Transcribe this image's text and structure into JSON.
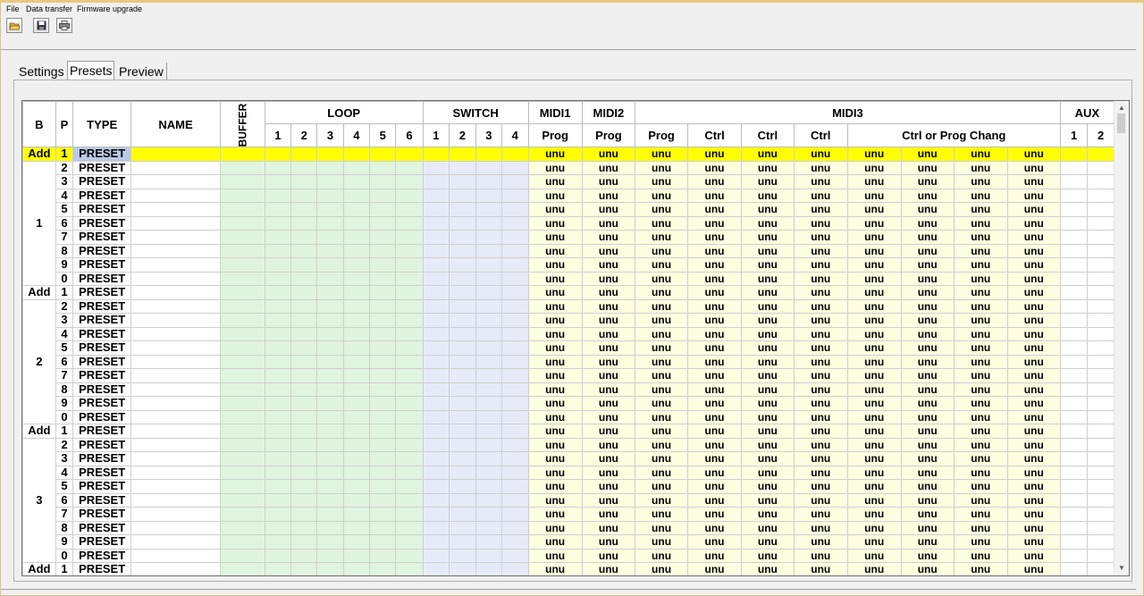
{
  "menu": [
    "File",
    "Data transfer",
    "Firmware upgrade"
  ],
  "toolbar": {
    "icons": [
      "open-folder-icon",
      "save-disk-icon",
      "print-icon"
    ]
  },
  "tabs": [
    {
      "label": "Settings",
      "active": false
    },
    {
      "label": "Presets",
      "active": true
    },
    {
      "label": "Preview",
      "active": false
    }
  ],
  "grid": {
    "headers": {
      "b": "B",
      "p": "P",
      "type": "TYPE",
      "name": "NAME",
      "buffer": "BUFFER",
      "loop": "LOOP",
      "loop_cols": [
        "1",
        "2",
        "3",
        "4",
        "5",
        "6"
      ],
      "switch": "SWITCH",
      "switch_cols": [
        "1",
        "2",
        "3",
        "4"
      ],
      "midi1": "MIDI1",
      "midi1_sub": "Prog",
      "midi2": "MIDI2",
      "midi2_sub": "Prog",
      "midi3": "MIDI3",
      "midi3_sub": [
        "Prog",
        "Ctrl",
        "Ctrl",
        "Ctrl"
      ],
      "midi3_span": "Ctrl or Prog Chang",
      "aux": "AUX",
      "aux_cols": [
        "1",
        "2"
      ]
    },
    "add_label": "Add",
    "type_value": "PRESET",
    "midi_value": "unu",
    "banks": [
      "1",
      "2",
      "3"
    ],
    "preset_numbers": [
      "1",
      "2",
      "3",
      "4",
      "5",
      "6",
      "7",
      "8",
      "9",
      "0"
    ],
    "partial_bank_preset": "1",
    "selected_row": 0
  },
  "colors": {
    "selected_row": "#ffff00",
    "loop_bg": "#dff5df",
    "switch_bg": "#e7eaf8",
    "midi_bg": "#fefee0"
  }
}
